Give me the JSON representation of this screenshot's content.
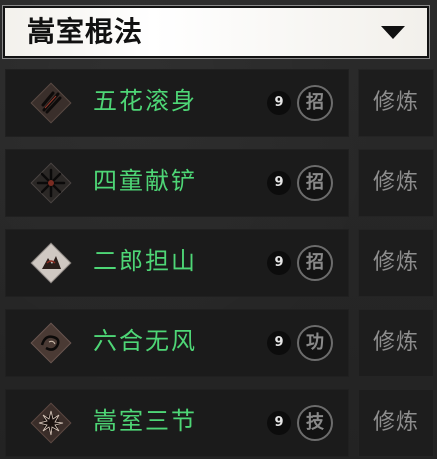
{
  "panel": {
    "title": "嵩室棍法",
    "dropdown_icon": "chevron-down-icon"
  },
  "skills": [
    {
      "name": "五花滚身",
      "level": "9",
      "type": "招",
      "action": "修炼",
      "icon": "whirl-slash-icon"
    },
    {
      "name": "四童献铲",
      "level": "9",
      "type": "招",
      "action": "修炼",
      "icon": "cross-spades-icon"
    },
    {
      "name": "二郎担山",
      "level": "9",
      "type": "招",
      "action": "修炼",
      "icon": "mountain-bird-icon"
    },
    {
      "name": "六合无风",
      "level": "9",
      "type": "功",
      "action": "修炼",
      "icon": "swirl-dragon-icon"
    },
    {
      "name": "嵩室三节",
      "level": "9",
      "type": "技",
      "action": "修炼",
      "icon": "flower-burst-icon"
    }
  ],
  "colors": {
    "skill_name": "#4ed676",
    "background": "#262626",
    "card": "#1b1b1b",
    "muted_text": "#8e8e8e"
  }
}
